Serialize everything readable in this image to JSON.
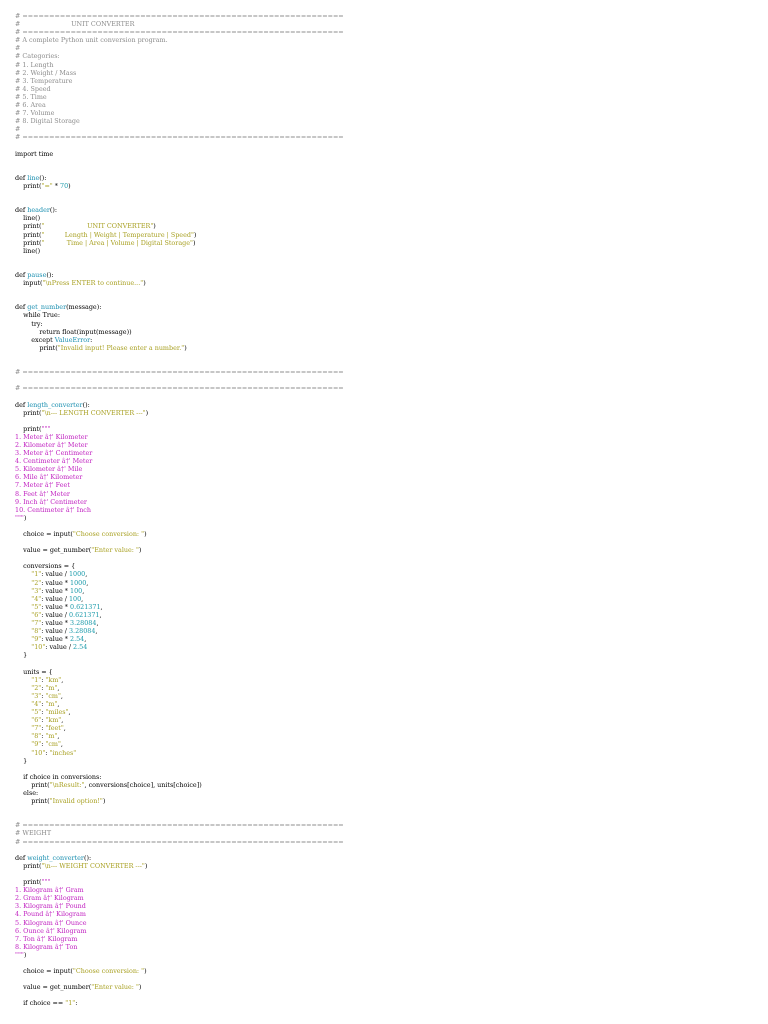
{
  "colors": {
    "comment": "#8c8c8c",
    "keyword": "#000000",
    "function_name": "#1a8fb0",
    "string": "#a8a022",
    "number": "#1a9aaa",
    "docstring": "#c020c0",
    "background": "#ffffff"
  },
  "lines": [
    {
      "tokens": [
        {
          "t": "c",
          "v": "# ============================================================"
        }
      ]
    },
    {
      "tokens": [
        {
          "t": "c",
          "v": "#                         UNIT CONVERTER"
        }
      ]
    },
    {
      "tokens": [
        {
          "t": "c",
          "v": "# ============================================================"
        }
      ]
    },
    {
      "tokens": [
        {
          "t": "c",
          "v": "# A complete Python unit conversion program."
        }
      ]
    },
    {
      "tokens": [
        {
          "t": "c",
          "v": "#"
        }
      ]
    },
    {
      "tokens": [
        {
          "t": "c",
          "v": "# Categories:"
        }
      ]
    },
    {
      "tokens": [
        {
          "t": "c",
          "v": "# 1. Length"
        }
      ]
    },
    {
      "tokens": [
        {
          "t": "c",
          "v": "# 2. Weight / Mass"
        }
      ]
    },
    {
      "tokens": [
        {
          "t": "c",
          "v": "# 3. Temperature"
        }
      ]
    },
    {
      "tokens": [
        {
          "t": "c",
          "v": "# 4. Speed"
        }
      ]
    },
    {
      "tokens": [
        {
          "t": "c",
          "v": "# 5. Time"
        }
      ]
    },
    {
      "tokens": [
        {
          "t": "c",
          "v": "# 6. Area"
        }
      ]
    },
    {
      "tokens": [
        {
          "t": "c",
          "v": "# 7. Volume"
        }
      ]
    },
    {
      "tokens": [
        {
          "t": "c",
          "v": "# 8. Digital Storage"
        }
      ]
    },
    {
      "tokens": [
        {
          "t": "c",
          "v": "#"
        }
      ]
    },
    {
      "tokens": [
        {
          "t": "c",
          "v": "# ============================================================"
        }
      ]
    },
    {
      "tokens": []
    },
    {
      "tokens": [
        {
          "t": "k",
          "v": "import time"
        }
      ]
    },
    {
      "tokens": []
    },
    {
      "tokens": []
    },
    {
      "tokens": [
        {
          "t": "k",
          "v": "def "
        },
        {
          "t": "f",
          "v": "line"
        },
        {
          "t": "b",
          "v": "():"
        }
      ]
    },
    {
      "tokens": [
        {
          "t": "b",
          "v": "    print("
        },
        {
          "t": "s",
          "v": "\"=\""
        },
        {
          "t": "b",
          "v": " * "
        },
        {
          "t": "n",
          "v": "70"
        },
        {
          "t": "b",
          "v": ")"
        }
      ]
    },
    {
      "tokens": []
    },
    {
      "tokens": []
    },
    {
      "tokens": [
        {
          "t": "k",
          "v": "def "
        },
        {
          "t": "f",
          "v": "header"
        },
        {
          "t": "b",
          "v": "():"
        }
      ]
    },
    {
      "tokens": [
        {
          "t": "b",
          "v": "    line()"
        }
      ]
    },
    {
      "tokens": [
        {
          "t": "b",
          "v": "    print("
        },
        {
          "t": "s",
          "v": "\"                     UNIT CONVERTER\""
        },
        {
          "t": "b",
          "v": ")"
        }
      ]
    },
    {
      "tokens": [
        {
          "t": "b",
          "v": "    print("
        },
        {
          "t": "s",
          "v": "\"          Length | Weight | Temperature | Speed\""
        },
        {
          "t": "b",
          "v": ")"
        }
      ]
    },
    {
      "tokens": [
        {
          "t": "b",
          "v": "    print("
        },
        {
          "t": "s",
          "v": "\"           Time | Area | Volume | Digital Storage\""
        },
        {
          "t": "b",
          "v": ")"
        }
      ]
    },
    {
      "tokens": [
        {
          "t": "b",
          "v": "    line()"
        }
      ]
    },
    {
      "tokens": []
    },
    {
      "tokens": []
    },
    {
      "tokens": [
        {
          "t": "k",
          "v": "def "
        },
        {
          "t": "f",
          "v": "pause"
        },
        {
          "t": "b",
          "v": "():"
        }
      ]
    },
    {
      "tokens": [
        {
          "t": "b",
          "v": "    input("
        },
        {
          "t": "s",
          "v": "\"\\nPress ENTER to continue...\""
        },
        {
          "t": "b",
          "v": ")"
        }
      ]
    },
    {
      "tokens": []
    },
    {
      "tokens": []
    },
    {
      "tokens": [
        {
          "t": "k",
          "v": "def "
        },
        {
          "t": "f",
          "v": "get_number"
        },
        {
          "t": "b",
          "v": "(message):"
        }
      ]
    },
    {
      "tokens": [
        {
          "t": "k",
          "v": "    while True:"
        }
      ]
    },
    {
      "tokens": [
        {
          "t": "k",
          "v": "        try:"
        }
      ]
    },
    {
      "tokens": [
        {
          "t": "k",
          "v": "            return float(input(message))"
        }
      ]
    },
    {
      "tokens": [
        {
          "t": "k",
          "v": "        except "
        },
        {
          "t": "f",
          "v": "ValueError"
        },
        {
          "t": "b",
          "v": ":"
        }
      ]
    },
    {
      "tokens": [
        {
          "t": "b",
          "v": "            print("
        },
        {
          "t": "s",
          "v": "\"Invalid input! Please enter a number.\""
        },
        {
          "t": "b",
          "v": ")"
        }
      ]
    },
    {
      "tokens": []
    },
    {
      "tokens": []
    },
    {
      "tokens": [
        {
          "t": "c",
          "v": "# ============================================================"
        }
      ]
    },
    {
      "tokens": [
        {
          "t": "c",
          "v": ""
        }
      ]
    },
    {
      "tokens": [
        {
          "t": "c",
          "v": "# ============================================================"
        }
      ]
    },
    {
      "tokens": []
    },
    {
      "tokens": [
        {
          "t": "k",
          "v": "def "
        },
        {
          "t": "f",
          "v": "length_converter"
        },
        {
          "t": "b",
          "v": "():"
        }
      ]
    },
    {
      "tokens": [
        {
          "t": "b",
          "v": "    print("
        },
        {
          "t": "s",
          "v": "\"\\n--- LENGTH CONVERTER ---\""
        },
        {
          "t": "b",
          "v": ")"
        }
      ]
    },
    {
      "tokens": []
    },
    {
      "tokens": [
        {
          "t": "b",
          "v": "    print("
        },
        {
          "t": "m",
          "v": "\"\"\""
        }
      ]
    },
    {
      "tokens": [
        {
          "t": "m",
          "v": "1. Meter â†' Kilometer"
        }
      ]
    },
    {
      "tokens": [
        {
          "t": "m",
          "v": "2. Kilometer â†' Meter"
        }
      ]
    },
    {
      "tokens": [
        {
          "t": "m",
          "v": "3. Meter â†' Centimeter"
        }
      ]
    },
    {
      "tokens": [
        {
          "t": "m",
          "v": "4. Centimeter â†' Meter"
        }
      ]
    },
    {
      "tokens": [
        {
          "t": "m",
          "v": "5. Kilometer â†' Mile"
        }
      ]
    },
    {
      "tokens": [
        {
          "t": "m",
          "v": "6. Mile â†' Kilometer"
        }
      ]
    },
    {
      "tokens": [
        {
          "t": "m",
          "v": "7. Meter â†' Feet"
        }
      ]
    },
    {
      "tokens": [
        {
          "t": "m",
          "v": "8. Feet â†' Meter"
        }
      ]
    },
    {
      "tokens": [
        {
          "t": "m",
          "v": "9. Inch â†' Centimeter"
        }
      ]
    },
    {
      "tokens": [
        {
          "t": "m",
          "v": "10. Centimeter â†' Inch"
        }
      ]
    },
    {
      "tokens": [
        {
          "t": "m",
          "v": "\"\"\""
        },
        {
          "t": "b",
          "v": ")"
        }
      ]
    },
    {
      "tokens": []
    },
    {
      "tokens": [
        {
          "t": "b",
          "v": "    choice = input("
        },
        {
          "t": "s",
          "v": "\"Choose conversion: \""
        },
        {
          "t": "b",
          "v": ")"
        }
      ]
    },
    {
      "tokens": []
    },
    {
      "tokens": [
        {
          "t": "b",
          "v": "    value = get_number("
        },
        {
          "t": "s",
          "v": "\"Enter value: \""
        },
        {
          "t": "b",
          "v": ")"
        }
      ]
    },
    {
      "tokens": []
    },
    {
      "tokens": [
        {
          "t": "b",
          "v": "    conversions = {"
        }
      ]
    },
    {
      "tokens": [
        {
          "t": "s",
          "v": "        \"1\""
        },
        {
          "t": "b",
          "v": ": value / "
        },
        {
          "t": "n",
          "v": "1000"
        },
        {
          "t": "b",
          "v": ","
        }
      ]
    },
    {
      "tokens": [
        {
          "t": "s",
          "v": "        \"2\""
        },
        {
          "t": "b",
          "v": ": value * "
        },
        {
          "t": "n",
          "v": "1000"
        },
        {
          "t": "b",
          "v": ","
        }
      ]
    },
    {
      "tokens": [
        {
          "t": "s",
          "v": "        \"3\""
        },
        {
          "t": "b",
          "v": ": value * "
        },
        {
          "t": "n",
          "v": "100"
        },
        {
          "t": "b",
          "v": ","
        }
      ]
    },
    {
      "tokens": [
        {
          "t": "s",
          "v": "        \"4\""
        },
        {
          "t": "b",
          "v": ": value / "
        },
        {
          "t": "n",
          "v": "100"
        },
        {
          "t": "b",
          "v": ","
        }
      ]
    },
    {
      "tokens": [
        {
          "t": "s",
          "v": "        \"5\""
        },
        {
          "t": "b",
          "v": ": value * "
        },
        {
          "t": "n",
          "v": "0.621371"
        },
        {
          "t": "b",
          "v": ","
        }
      ]
    },
    {
      "tokens": [
        {
          "t": "s",
          "v": "        \"6\""
        },
        {
          "t": "b",
          "v": ": value / "
        },
        {
          "t": "n",
          "v": "0.621371"
        },
        {
          "t": "b",
          "v": ","
        }
      ]
    },
    {
      "tokens": [
        {
          "t": "s",
          "v": "        \"7\""
        },
        {
          "t": "b",
          "v": ": value * "
        },
        {
          "t": "n",
          "v": "3.28084"
        },
        {
          "t": "b",
          "v": ","
        }
      ]
    },
    {
      "tokens": [
        {
          "t": "s",
          "v": "        \"8\""
        },
        {
          "t": "b",
          "v": ": value / "
        },
        {
          "t": "n",
          "v": "3.28084"
        },
        {
          "t": "b",
          "v": ","
        }
      ]
    },
    {
      "tokens": [
        {
          "t": "s",
          "v": "        \"9\""
        },
        {
          "t": "b",
          "v": ": value * "
        },
        {
          "t": "n",
          "v": "2.54"
        },
        {
          "t": "b",
          "v": ","
        }
      ]
    },
    {
      "tokens": [
        {
          "t": "s",
          "v": "        \"10\""
        },
        {
          "t": "b",
          "v": ": value / "
        },
        {
          "t": "n",
          "v": "2.54"
        }
      ]
    },
    {
      "tokens": [
        {
          "t": "b",
          "v": "    }"
        }
      ]
    },
    {
      "tokens": []
    },
    {
      "tokens": [
        {
          "t": "b",
          "v": "    units = {"
        }
      ]
    },
    {
      "tokens": [
        {
          "t": "s",
          "v": "        \"1\""
        },
        {
          "t": "b",
          "v": ": "
        },
        {
          "t": "s",
          "v": "\"km\""
        },
        {
          "t": "b",
          "v": ","
        }
      ]
    },
    {
      "tokens": [
        {
          "t": "s",
          "v": "        \"2\""
        },
        {
          "t": "b",
          "v": ": "
        },
        {
          "t": "s",
          "v": "\"m\""
        },
        {
          "t": "b",
          "v": ","
        }
      ]
    },
    {
      "tokens": [
        {
          "t": "s",
          "v": "        \"3\""
        },
        {
          "t": "b",
          "v": ": "
        },
        {
          "t": "s",
          "v": "\"cm\""
        },
        {
          "t": "b",
          "v": ","
        }
      ]
    },
    {
      "tokens": [
        {
          "t": "s",
          "v": "        \"4\""
        },
        {
          "t": "b",
          "v": ": "
        },
        {
          "t": "s",
          "v": "\"m\""
        },
        {
          "t": "b",
          "v": ","
        }
      ]
    },
    {
      "tokens": [
        {
          "t": "s",
          "v": "        \"5\""
        },
        {
          "t": "b",
          "v": ": "
        },
        {
          "t": "s",
          "v": "\"miles\""
        },
        {
          "t": "b",
          "v": ","
        }
      ]
    },
    {
      "tokens": [
        {
          "t": "s",
          "v": "        \"6\""
        },
        {
          "t": "b",
          "v": ": "
        },
        {
          "t": "s",
          "v": "\"km\""
        },
        {
          "t": "b",
          "v": ","
        }
      ]
    },
    {
      "tokens": [
        {
          "t": "s",
          "v": "        \"7\""
        },
        {
          "t": "b",
          "v": ": "
        },
        {
          "t": "s",
          "v": "\"feet\""
        },
        {
          "t": "b",
          "v": ","
        }
      ]
    },
    {
      "tokens": [
        {
          "t": "s",
          "v": "        \"8\""
        },
        {
          "t": "b",
          "v": ": "
        },
        {
          "t": "s",
          "v": "\"m\""
        },
        {
          "t": "b",
          "v": ","
        }
      ]
    },
    {
      "tokens": [
        {
          "t": "s",
          "v": "        \"9\""
        },
        {
          "t": "b",
          "v": ": "
        },
        {
          "t": "s",
          "v": "\"cm\""
        },
        {
          "t": "b",
          "v": ","
        }
      ]
    },
    {
      "tokens": [
        {
          "t": "s",
          "v": "        \"10\""
        },
        {
          "t": "b",
          "v": ": "
        },
        {
          "t": "s",
          "v": "\"inches\""
        }
      ]
    },
    {
      "tokens": [
        {
          "t": "b",
          "v": "    }"
        }
      ]
    },
    {
      "tokens": []
    },
    {
      "tokens": [
        {
          "t": "k",
          "v": "    if choice in conversions:"
        }
      ]
    },
    {
      "tokens": [
        {
          "t": "b",
          "v": "        print("
        },
        {
          "t": "s",
          "v": "\"\\nResult:\""
        },
        {
          "t": "b",
          "v": ", conversions[choice], units[choice])"
        }
      ]
    },
    {
      "tokens": [
        {
          "t": "k",
          "v": "    else:"
        }
      ]
    },
    {
      "tokens": [
        {
          "t": "b",
          "v": "        print("
        },
        {
          "t": "s",
          "v": "\"Invalid option!\""
        },
        {
          "t": "b",
          "v": ")"
        }
      ]
    },
    {
      "tokens": []
    },
    {
      "tokens": []
    },
    {
      "tokens": [
        {
          "t": "c",
          "v": "# ============================================================"
        }
      ]
    },
    {
      "tokens": [
        {
          "t": "c",
          "v": "# WEIGHT"
        }
      ]
    },
    {
      "tokens": [
        {
          "t": "c",
          "v": "# ============================================================"
        }
      ]
    },
    {
      "tokens": []
    },
    {
      "tokens": [
        {
          "t": "k",
          "v": "def "
        },
        {
          "t": "f",
          "v": "weight_converter"
        },
        {
          "t": "b",
          "v": "():"
        }
      ]
    },
    {
      "tokens": [
        {
          "t": "b",
          "v": "    print("
        },
        {
          "t": "s",
          "v": "\"\\n--- WEIGHT CONVERTER ---\""
        },
        {
          "t": "b",
          "v": ")"
        }
      ]
    },
    {
      "tokens": []
    },
    {
      "tokens": [
        {
          "t": "b",
          "v": "    print("
        },
        {
          "t": "m",
          "v": "\"\"\""
        }
      ]
    },
    {
      "tokens": [
        {
          "t": "m",
          "v": "1. Kilogram â†' Gram"
        }
      ]
    },
    {
      "tokens": [
        {
          "t": "m",
          "v": "2. Gram â†' Kilogram"
        }
      ]
    },
    {
      "tokens": [
        {
          "t": "m",
          "v": "3. Kilogram â†' Pound"
        }
      ]
    },
    {
      "tokens": [
        {
          "t": "m",
          "v": "4. Pound â†' Kilogram"
        }
      ]
    },
    {
      "tokens": [
        {
          "t": "m",
          "v": "5. Kilogram â†' Ounce"
        }
      ]
    },
    {
      "tokens": [
        {
          "t": "m",
          "v": "6. Ounce â†' Kilogram"
        }
      ]
    },
    {
      "tokens": [
        {
          "t": "m",
          "v": "7. Ton â†' Kilogram"
        }
      ]
    },
    {
      "tokens": [
        {
          "t": "m",
          "v": "8. Kilogram â†' Ton"
        }
      ]
    },
    {
      "tokens": [
        {
          "t": "m",
          "v": "\"\"\""
        },
        {
          "t": "b",
          "v": ")"
        }
      ]
    },
    {
      "tokens": []
    },
    {
      "tokens": [
        {
          "t": "b",
          "v": "    choice = input("
        },
        {
          "t": "s",
          "v": "\"Choose conversion: \""
        },
        {
          "t": "b",
          "v": ")"
        }
      ]
    },
    {
      "tokens": []
    },
    {
      "tokens": [
        {
          "t": "b",
          "v": "    value = get_number("
        },
        {
          "t": "s",
          "v": "\"Enter value: \""
        },
        {
          "t": "b",
          "v": ")"
        }
      ]
    },
    {
      "tokens": []
    },
    {
      "tokens": [
        {
          "t": "k",
          "v": "    if choice == "
        },
        {
          "t": "s",
          "v": "\"1\""
        },
        {
          "t": "b",
          "v": ":"
        }
      ]
    }
  ]
}
